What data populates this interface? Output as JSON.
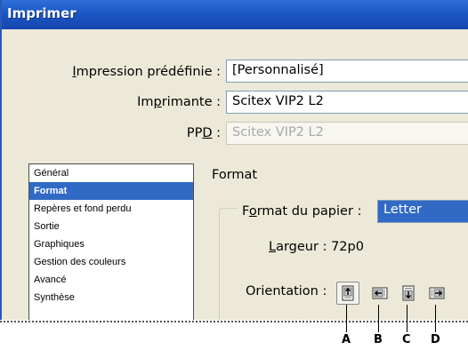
{
  "window": {
    "title": "Imprimer"
  },
  "fields": {
    "preset": {
      "label_pre": "",
      "label_u": "I",
      "label_post": "mpression prédéfinie :",
      "value": "[Personnalisé]"
    },
    "printer": {
      "label_pre": "Im",
      "label_u": "p",
      "label_post": "rimante :",
      "value": "Scitex VIP2 L2"
    },
    "ppd": {
      "label_pre": "PP",
      "label_u": "D",
      "label_post": " :",
      "value": "Scitex VIP2 L2"
    }
  },
  "sidebar": {
    "items": [
      {
        "label": "Général"
      },
      {
        "label": "Format"
      },
      {
        "label": "Repères et fond perdu"
      },
      {
        "label": "Sortie"
      },
      {
        "label": "Graphiques"
      },
      {
        "label": "Gestion des couleurs"
      },
      {
        "label": "Avancé"
      },
      {
        "label": "Synthèse"
      }
    ],
    "selected": "Format"
  },
  "format": {
    "section_title": "Format",
    "paper_label_pre": "F",
    "paper_label_u": "o",
    "paper_label_post": "rmat du papier :",
    "paper_value": "Letter",
    "width_label_u": "L",
    "width_label_post": "argeur : 72p0",
    "orientation_label": "Orientation :",
    "orientation_icons": [
      "portrait-icon",
      "landscape-icon",
      "reverse-portrait-icon",
      "reverse-landscape-icon"
    ]
  },
  "callouts": [
    "A",
    "B",
    "C",
    "D"
  ]
}
